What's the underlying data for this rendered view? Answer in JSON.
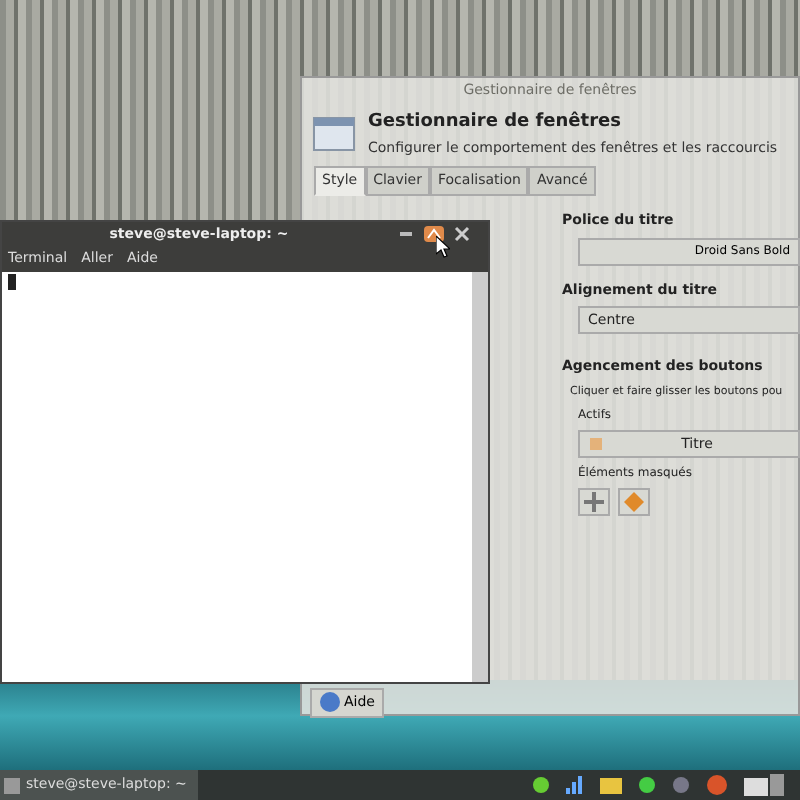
{
  "settings_window": {
    "titlebar_title": "Gestionnaire de fenêtres",
    "title": "Gestionnaire de fenêtres",
    "subtitle": "Configurer le comportement des fenêtres et les raccourcis",
    "tabs": [
      {
        "label": "Style",
        "selected": true
      },
      {
        "label": "Clavier",
        "selected": false
      },
      {
        "label": "Focalisation",
        "selected": false
      },
      {
        "label": "Avancé",
        "selected": false
      }
    ],
    "title_font_label": "Police du titre",
    "title_font": "Droid Sans Bold",
    "alignment_label": "Alignement du titre",
    "alignment": "Centre",
    "buttons_layout_label": "Agencement des boutons",
    "buttons_layout_hint": "Cliquer et faire glisser les boutons pou",
    "active_label": "Actifs",
    "active_title": "Titre",
    "hidden_label": "Éléments masqués",
    "help_button": "Aide"
  },
  "terminal": {
    "title": "steve@steve-laptop: ~",
    "menu": [
      "Terminal",
      "Aller",
      "Aide"
    ]
  },
  "taskbar": {
    "tasks": [
      {
        "label": "steve@steve-laptop: ~",
        "selected": false
      }
    ]
  }
}
